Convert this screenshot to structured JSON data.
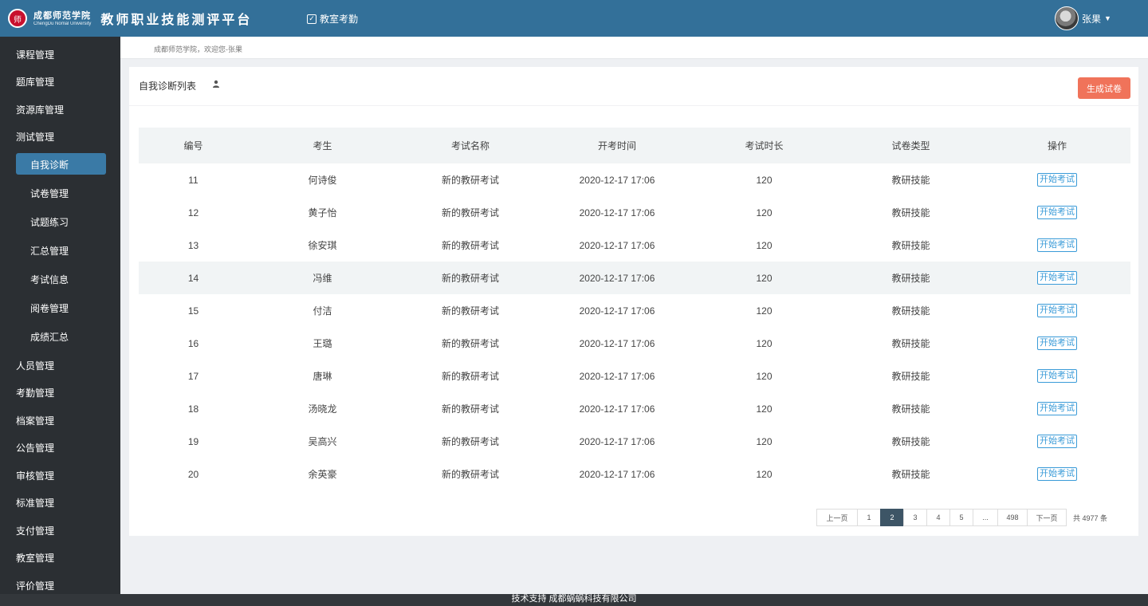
{
  "header": {
    "seal_text": "师",
    "university_cn": "成都师范学院",
    "university_en": "ChengDu Nomal University",
    "platform_title": "教师职业技能测评平台",
    "nav_item": "教室考勤",
    "user_name": "张果",
    "brand_color": "#337099"
  },
  "sidebar": {
    "items": [
      {
        "label": "课程管理"
      },
      {
        "label": "题库管理"
      },
      {
        "label": "资源库管理"
      },
      {
        "label": "测试管理"
      },
      {
        "label": "人员管理"
      },
      {
        "label": "考勤管理"
      },
      {
        "label": "档案管理"
      },
      {
        "label": "公告管理"
      },
      {
        "label": "审核管理"
      },
      {
        "label": "标准管理"
      },
      {
        "label": "支付管理"
      },
      {
        "label": "教室管理"
      },
      {
        "label": "评价管理"
      }
    ],
    "sub_items": [
      {
        "label": "自我诊断",
        "active": true
      },
      {
        "label": "试卷管理"
      },
      {
        "label": "试题练习"
      },
      {
        "label": "汇总管理"
      },
      {
        "label": "考试信息"
      },
      {
        "label": "阅卷管理"
      },
      {
        "label": "成绩汇总"
      }
    ]
  },
  "breadcrumb": "成都师范学院，欢迎您-张果",
  "panel": {
    "title": "自我诊断列表",
    "generate_button": "生成试卷",
    "generate_button_color": "#f0735a"
  },
  "table": {
    "headers": [
      "编号",
      "考生",
      "考试名称",
      "开考时间",
      "考试时长",
      "试卷类型",
      "操作"
    ],
    "action_label": "开始考试",
    "rows": [
      {
        "id": "11",
        "name": "何诗俊",
        "exam": "新的教研考试",
        "time": "2020-12-17 17:06",
        "duration": "120",
        "type": "教研技能"
      },
      {
        "id": "12",
        "name": "黄子怡",
        "exam": "新的教研考试",
        "time": "2020-12-17 17:06",
        "duration": "120",
        "type": "教研技能"
      },
      {
        "id": "13",
        "name": "徐安琪",
        "exam": "新的教研考试",
        "time": "2020-12-17 17:06",
        "duration": "120",
        "type": "教研技能"
      },
      {
        "id": "14",
        "name": "冯维",
        "exam": "新的教研考试",
        "time": "2020-12-17 17:06",
        "duration": "120",
        "type": "教研技能"
      },
      {
        "id": "15",
        "name": "付洁",
        "exam": "新的教研考试",
        "time": "2020-12-17 17:06",
        "duration": "120",
        "type": "教研技能"
      },
      {
        "id": "16",
        "name": "王璐",
        "exam": "新的教研考试",
        "time": "2020-12-17 17:06",
        "duration": "120",
        "type": "教研技能"
      },
      {
        "id": "17",
        "name": "唐琳",
        "exam": "新的教研考试",
        "time": "2020-12-17 17:06",
        "duration": "120",
        "type": "教研技能"
      },
      {
        "id": "18",
        "name": "汤晓龙",
        "exam": "新的教研考试",
        "time": "2020-12-17 17:06",
        "duration": "120",
        "type": "教研技能"
      },
      {
        "id": "19",
        "name": "吴高兴",
        "exam": "新的教研考试",
        "time": "2020-12-17 17:06",
        "duration": "120",
        "type": "教研技能"
      },
      {
        "id": "20",
        "name": "余英豪",
        "exam": "新的教研考试",
        "time": "2020-12-17 17:06",
        "duration": "120",
        "type": "教研技能"
      }
    ]
  },
  "pagination": {
    "prev": "上一页",
    "pages": [
      "1",
      "2",
      "3",
      "4",
      "5",
      "...",
      "498"
    ],
    "current": "2",
    "next": "下一页",
    "total": "共 4977 条"
  },
  "footer": "技术支持 成都蜗蜗科技有限公司"
}
